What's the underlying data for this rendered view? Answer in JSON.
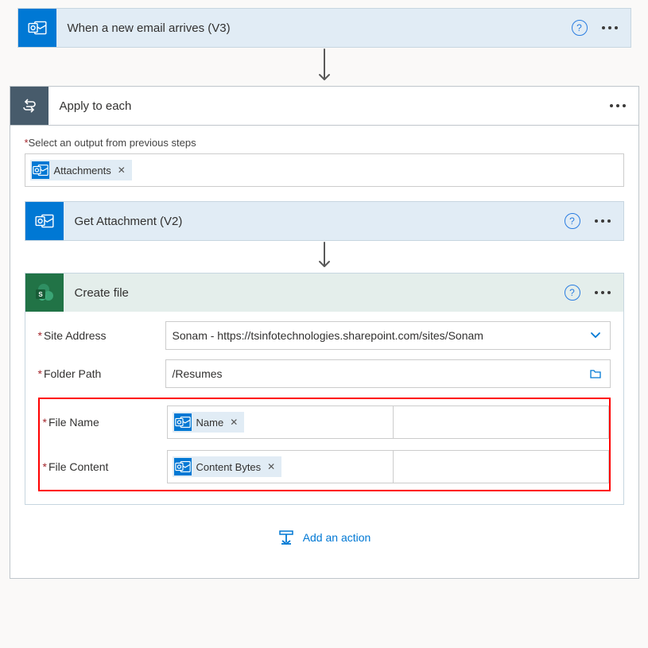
{
  "trigger": {
    "title": "When a new email arrives (V3)"
  },
  "apply": {
    "title": "Apply to each",
    "select_label": "Select an output from previous steps",
    "token": "Attachments"
  },
  "getAttachment": {
    "title": "Get Attachment (V2)"
  },
  "createFile": {
    "title": "Create file",
    "fields": {
      "siteAddress": {
        "label": "Site Address",
        "value": "Sonam - https://tsinfotechnologies.sharepoint.com/sites/Sonam"
      },
      "folderPath": {
        "label": "Folder Path",
        "value": "/Resumes"
      },
      "fileName": {
        "label": "File Name",
        "token": "Name"
      },
      "fileContent": {
        "label": "File Content",
        "token": "Content Bytes"
      }
    }
  },
  "addAction": "Add an action"
}
